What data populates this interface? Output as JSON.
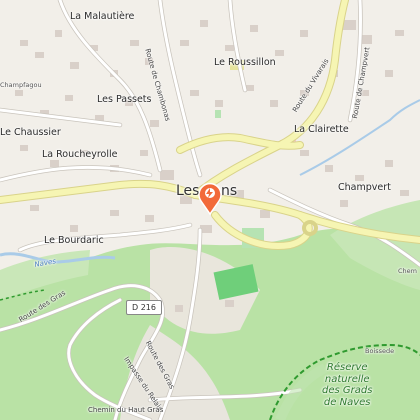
{
  "map": {
    "places": {
      "la_malautiere": "La Malautière",
      "le_roussillon": "Le Roussillon",
      "les_passets": "Les Passets",
      "le_chaussier": "Le Chaussier",
      "la_roucheyrolle": "La Roucheyrolle",
      "la_clairette": "La Clairette",
      "champvert": "Champvert",
      "le_bourdaric": "Le Bourdaric",
      "les_vans": "Les Vans",
      "boissede": "Boissede",
      "champfagou": "Champfagou",
      "chemin_edge": "Chem"
    },
    "roads": {
      "route_chambonas": "Route de Chambonas",
      "route_vivarais": "Route du Vivarais",
      "route_champvert": "Route de Champvert",
      "route_gras": "Route des Gras",
      "route_gras2": "Route des Gras",
      "impasse_relais": "Impasse du Relais",
      "chemin_haut_gras": "Chemin du Haut Gras",
      "d216": "D 216"
    },
    "water": {
      "naves": "Naves"
    },
    "reserve": {
      "label": "Réserve\nnaturelle\ndes Grads\nde Naves"
    },
    "marker_icon": "location-pin-icon",
    "colors": {
      "background": "#f2efe9",
      "main_road": "#f6f5b3",
      "main_road_casing": "#d9d38a",
      "forest": "#b7e0a4",
      "park": "#cdeacf",
      "river": "#a9cbe8",
      "building": "#d9d0c9",
      "marker": "#f26a3a",
      "reserve_border": "#2f9a2f"
    }
  }
}
